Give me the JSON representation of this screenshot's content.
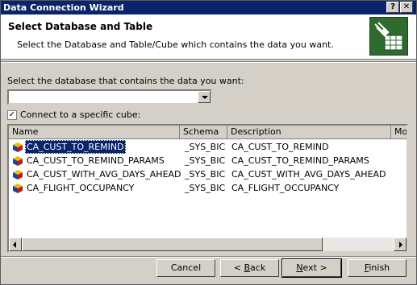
{
  "window": {
    "title": "Data Connection Wizard",
    "help_label": "?",
    "close_label": "✕"
  },
  "header": {
    "title": "Select Database and Table",
    "subtitle": "Select the Database and Table/Cube which contains the data you want."
  },
  "database": {
    "label": "Select the database that contains the data you want:",
    "value": ""
  },
  "cube_option": {
    "checked": true,
    "check_mark": "✓",
    "label": "Connect to a specific cube:"
  },
  "table": {
    "columns": [
      "Name",
      "Schema",
      "Description",
      "Moc"
    ],
    "rows": [
      {
        "name": "CA_CUST_TO_REMIND",
        "schema": "_SYS_BIC",
        "description": "CA_CUST_TO_REMIND",
        "selected": true
      },
      {
        "name": "CA_CUST_TO_REMIND_PARAMS",
        "schema": "_SYS_BIC",
        "description": "CA_CUST_TO_REMIND_PARAMS",
        "selected": false
      },
      {
        "name": "CA_CUST_WITH_AVG_DAYS_AHEAD",
        "schema": "_SYS_BIC",
        "description": "CA_CUST_WITH_AVG_DAYS_AHEAD",
        "selected": false
      },
      {
        "name": "CA_FLIGHT_OCCUPANCY",
        "schema": "_SYS_BIC",
        "description": "CA_FLIGHT_OCCUPANCY",
        "selected": false
      }
    ]
  },
  "buttons": {
    "cancel": "Cancel",
    "back_prefix": "< ",
    "back_key": "B",
    "back_rest": "ack",
    "next_key": "N",
    "next_rest": "ext >",
    "finish_key": "F",
    "finish_rest": "inish"
  },
  "colors": {
    "title_bar": "#0a246a",
    "selection": "#0a246a",
    "face": "#d4d0c8"
  }
}
